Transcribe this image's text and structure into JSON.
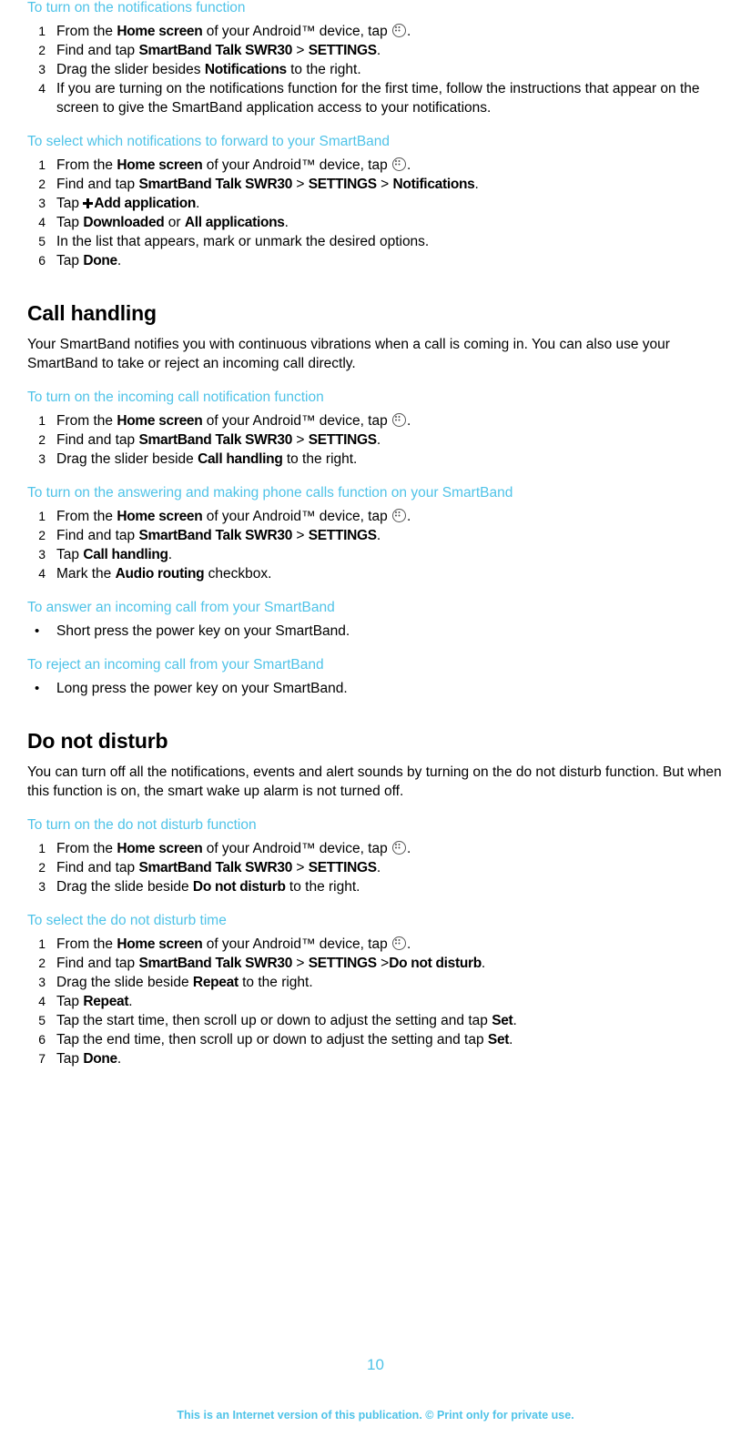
{
  "page": {
    "number": "10",
    "footer_note": "This is an Internet version of this publication. © Print only for private use."
  },
  "sections": [
    {
      "id": "notifications-on",
      "heading": "To turn on the notifications function",
      "steps": [
        "From the <b>Home screen</b> of your Android™ device, tap <span class=\"apps-icon\" data-name=\"apps-grid-icon\" data-interactable=\"false\"></span>.",
        "Find and tap <b>SmartBand Talk SWR30</b> &gt; <b>SETTINGS</b>.",
        "Drag the slider besides <b>Notifications</b> to the right.",
        "If you are turning on the notifications function for the first time, follow the instructions that appear on the screen to give the SmartBand application access to your notifications."
      ]
    },
    {
      "id": "select-notifications",
      "heading": "To select which notifications to forward to your SmartBand",
      "steps": [
        "From the <b>Home screen</b> of your Android™ device, tap <span class=\"apps-icon\" data-name=\"apps-grid-icon\" data-interactable=\"false\"></span>.",
        "Find and tap <b>SmartBand Talk SWR30</b> &gt; <b>SETTINGS</b> &gt; <b>Notifications</b>.",
        "Tap <span class=\"plus-icon\" data-name=\"plus-icon\" data-interactable=\"false\"></span><b>Add application</b>.",
        "Tap <b>Downloaded</b> or <b>All applications</b>.",
        "In the list that appears, mark or unmark the desired options.",
        "Tap <b>Done</b>."
      ]
    }
  ],
  "call_handling": {
    "title": "Call handling",
    "intro": "Your SmartBand notifies you with continuous vibrations when a call is coming in. You can also use your SmartBand to take or reject an incoming call directly.",
    "sections": [
      {
        "id": "incoming-call-notification",
        "heading": "To turn on the incoming call notification function",
        "steps": [
          "From the <b>Home screen</b> of your Android™ device, tap <span class=\"apps-icon\" data-name=\"apps-grid-icon\" data-interactable=\"false\"></span>.",
          "Find and tap <b>SmartBand Talk SWR30</b> &gt; <b>SETTINGS</b>.",
          "Drag the slider beside <b>Call handling</b> to the right."
        ]
      },
      {
        "id": "answering-making-calls",
        "heading": "To turn on the answering and making phone calls function on your SmartBand",
        "steps": [
          "From the <b>Home screen</b> of your Android™ device, tap <span class=\"apps-icon\" data-name=\"apps-grid-icon\" data-interactable=\"false\"></span>.",
          "Find and tap <b>SmartBand Talk SWR30</b> &gt; <b>SETTINGS</b>.",
          "Tap <b>Call handling</b>.",
          "Mark the <b>Audio routing</b> checkbox."
        ]
      },
      {
        "id": "answer-incoming-call",
        "heading": "To answer an incoming call from your SmartBand",
        "bullets": [
          "Short press the power key on your SmartBand."
        ]
      },
      {
        "id": "reject-incoming-call",
        "heading": "To reject an incoming call from your SmartBand",
        "bullets": [
          "Long press the power key on your SmartBand."
        ]
      }
    ]
  },
  "do_not_disturb": {
    "title": "Do not disturb",
    "intro": "You can turn off all the notifications, events and alert sounds by turning on the do not disturb function. But when this function is on, the smart wake up alarm is not turned off.",
    "sections": [
      {
        "id": "dnd-on",
        "heading": "To turn on the do not disturb function",
        "steps": [
          "From the <b>Home screen</b> of your Android™ device, tap <span class=\"apps-icon\" data-name=\"apps-grid-icon\" data-interactable=\"false\"></span>.",
          "Find and tap <b>SmartBand Talk SWR30</b> &gt; <b>SETTINGS</b>.",
          "Drag the slide beside <b>Do not disturb</b> to the right."
        ]
      },
      {
        "id": "dnd-time",
        "heading": "To select the do not disturb time",
        "steps": [
          "From the <b>Home screen</b> of your Android™ device, tap <span class=\"apps-icon\" data-name=\"apps-grid-icon\" data-interactable=\"false\"></span>.",
          "Find and tap <b>SmartBand Talk SWR30</b> &gt; <b>SETTINGS</b> &gt;<b>Do not disturb</b>.",
          "Drag the slide beside <b>Repeat</b> to the right.",
          "Tap <b>Repeat</b>.",
          "Tap the start time, then scroll up or down to adjust the setting and tap <b>Set</b>.",
          "Tap the end time, then scroll up or down to adjust the setting and tap <b>Set</b>.",
          "Tap <b>Done</b>."
        ]
      }
    ]
  },
  "colors": {
    "heading_accent": "#4fc3e8",
    "text": "#000000"
  }
}
